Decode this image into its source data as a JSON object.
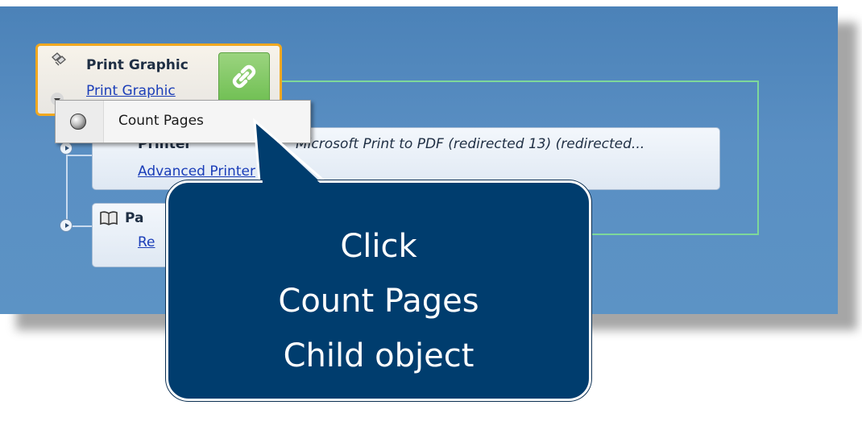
{
  "workflow": {
    "main_node": {
      "title": "Print Graphic",
      "link": "Print Graphic",
      "icon": "print-graphic-icon",
      "link_button_icon": "chain-link-icon"
    },
    "printer_node": {
      "title_partial": "Printer",
      "link_partial": "Advanced Printer",
      "detail": "Microsoft Print to PDF (redirected 13) (redirected..."
    },
    "pages_node": {
      "title_partial": "Pa",
      "link_partial": "Re",
      "icon": "book-icon"
    }
  },
  "context_menu": {
    "items": [
      {
        "label": "Count Pages",
        "icon": "radio-circle-icon"
      }
    ]
  },
  "callout": {
    "lines": [
      "Click",
      "Count Pages",
      "Child object"
    ]
  },
  "colors": {
    "canvas_blue": "#5a8fc3",
    "selection_orange": "#f0a820",
    "connector_green": "#7ed89a",
    "callout_navy": "#003d6e",
    "link_green": "#6fbf52"
  }
}
